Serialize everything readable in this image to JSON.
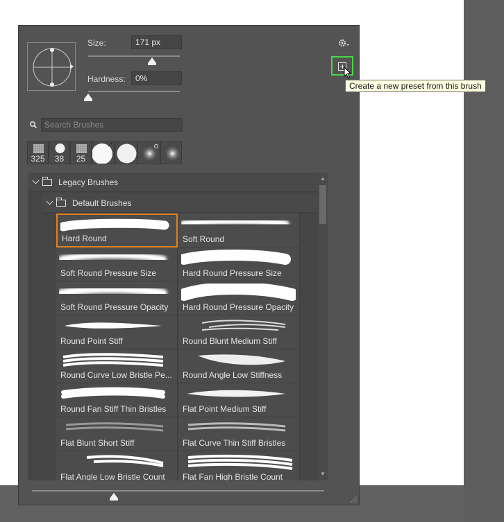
{
  "panel": {
    "size_label": "Size:",
    "size_value": "171 px",
    "hardness_label": "Hardness:",
    "hardness_value": "0%",
    "size_level": 0.7,
    "hardness_level": 0.0,
    "bottom_slider_level": 0.28
  },
  "tooltip": {
    "text": "Create a new preset from this brush"
  },
  "search": {
    "placeholder": "Search Brushes"
  },
  "recent_brushes": [
    {
      "label": "325",
      "icon": "textured-brush-icon"
    },
    {
      "label": "38",
      "icon": "hard-round-brush-icon"
    },
    {
      "label": "25",
      "icon": "textured-brush-icon"
    },
    {
      "label": "",
      "icon": "large-round-brush-icon"
    },
    {
      "label": "",
      "icon": "round-brush-icon"
    },
    {
      "label": "",
      "icon": "soft-round-brush-icon"
    },
    {
      "label": "",
      "icon": "soft-round-brush-icon"
    }
  ],
  "folders": {
    "legacy": "Legacy Brushes",
    "default": "Default Brushes"
  },
  "brushes": [
    "Hard Round",
    "Soft Round",
    "Soft Round Pressure Size",
    "Hard Round Pressure Size",
    "Soft Round Pressure Opacity",
    "Hard Round Pressure Opacity",
    "Round Point Stiff",
    "Round Blunt Medium Stiff",
    "Round Curve Low Bristle Pe...",
    "Round Angle Low Stiffness",
    "Round Fan Stiff Thin Bristles",
    "Flat Point Medium Stiff",
    "Flat Blunt Short Stiff",
    "Flat Curve Thin Stiff Bristles",
    "Flat Angle Low Bristle Count",
    "Flat Fan High Bristle Count"
  ],
  "selected_brush": "Hard Round",
  "colors": {
    "selection": "#e2801d",
    "highlight_button": "#4cd64c",
    "tooltip_bg": "#ffffe1"
  }
}
